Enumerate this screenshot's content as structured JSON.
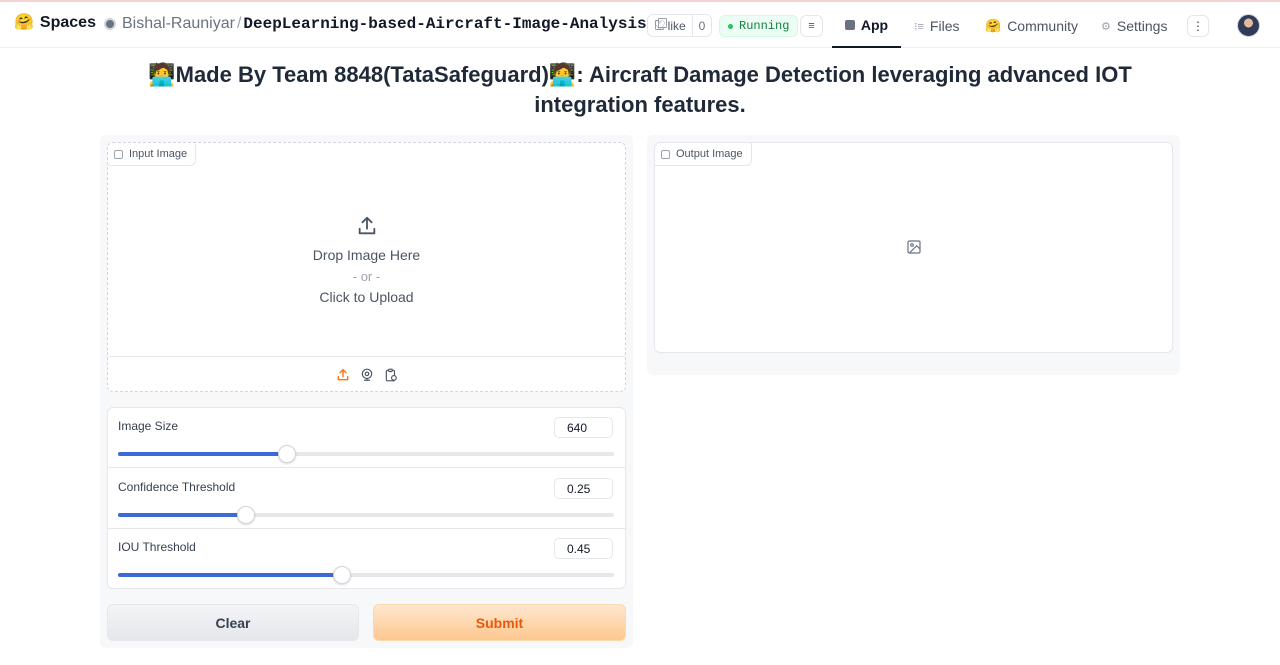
{
  "nav": {
    "brand": "Spaces",
    "owner": "Bishal-Rauniyar",
    "separator": "/",
    "repo": "DeepLearning-based-Aircraft-Image-Analysis",
    "like_label": "like",
    "like_count": "0",
    "status": "Running",
    "tabs": [
      {
        "label": "App",
        "icon": "cube-icon",
        "active": true
      },
      {
        "label": "Files",
        "icon": "files-icon",
        "active": false
      },
      {
        "label": "Community",
        "icon": "hugging-face-icon",
        "active": false
      },
      {
        "label": "Settings",
        "icon": "gear-icon",
        "active": false
      }
    ],
    "more_icon": "⋮"
  },
  "title": "🧑‍💻Made By Team 8848(TataSafeguard)🧑‍💻: Aircraft Damage Detection leveraging advanced IOT integration features.",
  "input_image": {
    "label": "Input Image",
    "drop_text": "Drop Image Here",
    "or_text": "- or -",
    "click_text": "Click to Upload",
    "sources": [
      "upload-icon",
      "webcam-icon",
      "clipboard-icon"
    ]
  },
  "output_image": {
    "label": "Output Image"
  },
  "sliders": [
    {
      "label": "Image Size",
      "value": "640",
      "fraction": 0.34
    },
    {
      "label": "Confidence Threshold",
      "value": "0.25",
      "fraction": 0.258
    },
    {
      "label": "IOU Threshold",
      "value": "0.45",
      "fraction": 0.451
    }
  ],
  "buttons": {
    "clear": "Clear",
    "submit": "Submit"
  },
  "colors": {
    "accent": "#3b6ad6",
    "submit_text": "#ea580c",
    "running": "#15803d"
  }
}
